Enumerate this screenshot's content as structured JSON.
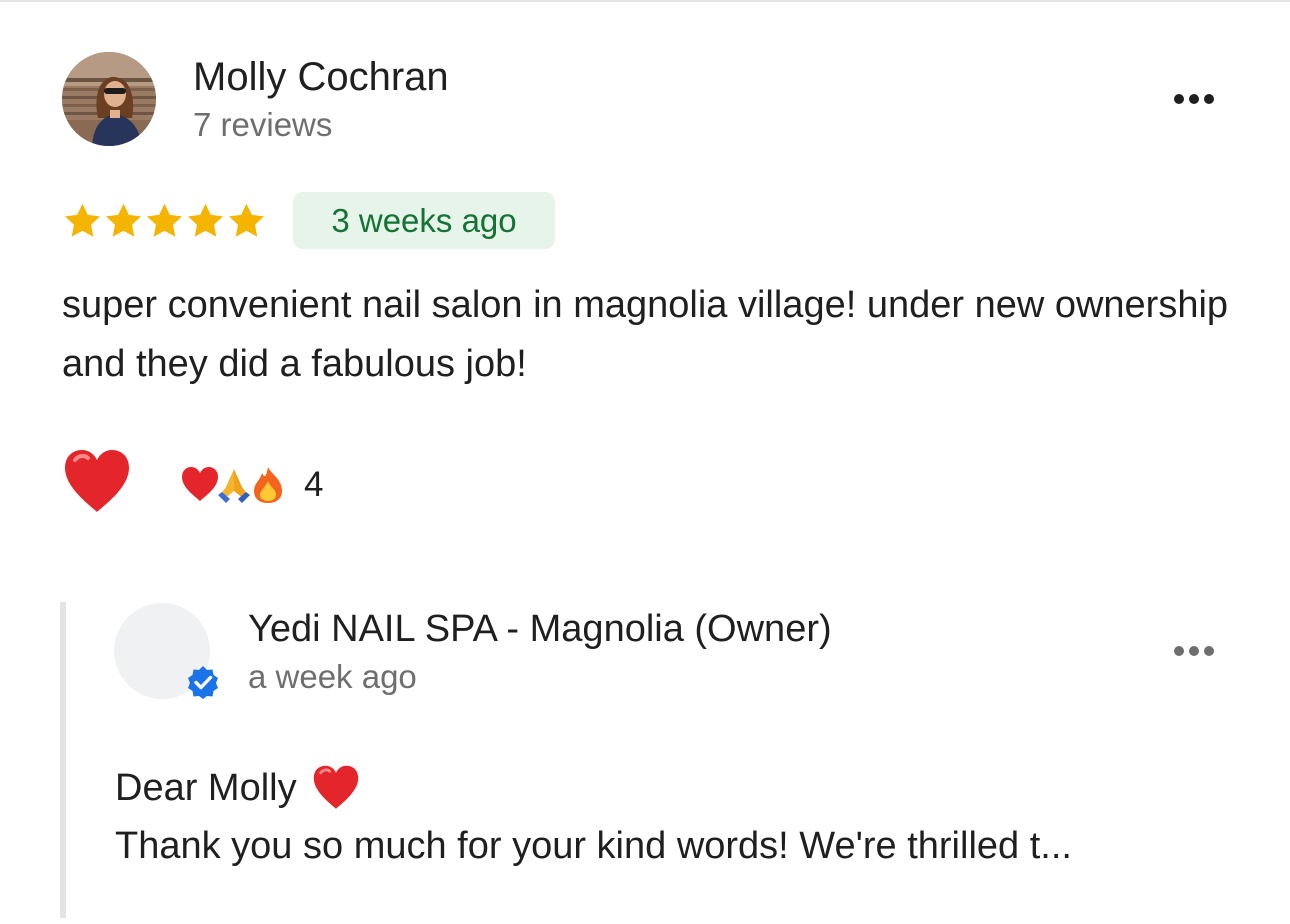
{
  "review": {
    "reviewer": {
      "name": "Molly Cochran",
      "review_count": "7 reviews",
      "avatar": "profile-photo"
    },
    "rating": {
      "value": 5,
      "max": 5,
      "color": "#f4b400",
      "icon": "star-icon"
    },
    "time_ago": "3 weeks ago",
    "badge_colors": {
      "background": "#e6f4ea",
      "text": "#137333"
    },
    "text": "super convenient nail salon in magnolia village! under new ownership and they did a fabulous job!",
    "more_icon": "more-horizontal-icon"
  },
  "reactions": {
    "react_icon": "heart-emoji-icon",
    "summary_icons": [
      "heart-emoji-icon",
      "folded-hands-emoji-icon",
      "fire-emoji-icon"
    ],
    "count": "4"
  },
  "owner_reply": {
    "name": "Yedi NAIL SPA - Magnolia (Owner)",
    "time_ago": "a week ago",
    "verified_icon": "verified-badge-icon",
    "verified_color": "#1a73e8",
    "greeting": "Dear Molly",
    "greeting_icon": "heart-emoji-icon",
    "text": "Thank you so much for your kind words! We're thrilled t..."
  }
}
